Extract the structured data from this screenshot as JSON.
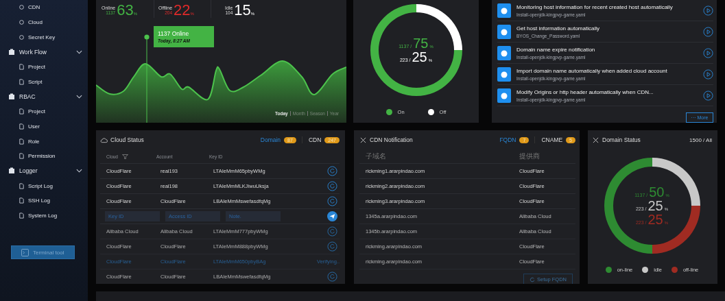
{
  "sidebar": {
    "items": [
      {
        "label": "CDN"
      },
      {
        "label": "Cloud"
      },
      {
        "label": "Secret Key"
      },
      {
        "label": "Work Flow",
        "expanded": true,
        "children": [
          {
            "label": "Project"
          },
          {
            "label": "Script"
          }
        ]
      },
      {
        "label": "RBAC",
        "expanded": true,
        "children": [
          {
            "label": "Project"
          },
          {
            "label": "User"
          },
          {
            "label": "Role"
          },
          {
            "label": "Permission"
          }
        ]
      },
      {
        "label": "Logger",
        "expanded": true,
        "children": [
          {
            "label": "Script Log"
          },
          {
            "label": "SSH Log"
          },
          {
            "label": "System Log"
          }
        ]
      }
    ],
    "terminal_button": "Terminal tool"
  },
  "activity": {
    "stats": [
      {
        "kind": "online",
        "label": "Online",
        "count": "1137",
        "percent": "63",
        "unit": "%"
      },
      {
        "kind": "offline",
        "label": "Offline",
        "count": "204",
        "percent": "22",
        "unit": "%"
      },
      {
        "kind": "idle",
        "label": "Idle",
        "count": "104",
        "percent": "15",
        "unit": "%"
      }
    ],
    "tooltip": {
      "title": "1137 Online",
      "time": "Today, 8:27 AM"
    },
    "ranges": [
      {
        "label": "Today",
        "selected": true
      },
      {
        "label": "Month",
        "selected": false
      },
      {
        "label": "Season",
        "selected": false
      },
      {
        "label": "Year",
        "selected": false
      }
    ]
  },
  "power": {
    "chart_data": {
      "type": "donut",
      "categories": [
        "On",
        "Off"
      ],
      "values": [
        75,
        25
      ]
    },
    "lines": [
      {
        "count": "1137 /",
        "percent": "75",
        "unit": "%"
      },
      {
        "count": "223 /",
        "percent": "25",
        "unit": "%"
      }
    ],
    "legend": [
      {
        "color": "#43b344"
      },
      {
        "color": "#ffffff"
      }
    ]
  },
  "workflows": {
    "items": [
      {
        "title": "Monitoring host information for recent created host automatically",
        "file": "Install-openjdk-kingpvp-game.yaml"
      },
      {
        "title": "Get host information automatically",
        "file": "BYOS_Change_Password.yaml"
      },
      {
        "title": "Domain name expire notification",
        "file": "Install-openjdk-kingpvp-game.yaml"
      },
      {
        "title": "Import domain name automatically when added cloud account",
        "file": "Install-openjdk-kingpvp-game.yaml"
      },
      {
        "title": "Modify Origins or http header automatically when CDN...",
        "file": "Install-openjdk-kingpvp-game.yaml"
      }
    ],
    "more": "··· More"
  },
  "cloud_status": {
    "title": "Cloud Status",
    "tabs": [
      {
        "label": "Domain",
        "count": "87",
        "selected": true
      },
      {
        "label": "CDN",
        "count": "247",
        "selected": false
      }
    ],
    "columns": [
      "Cloud",
      "Account",
      "Key ID"
    ],
    "rows": [
      {
        "kind": "data",
        "cloud": "CloudFlare",
        "account": "real193",
        "key_id": "LTAIeMmM65pbyWMg"
      },
      {
        "kind": "data",
        "cloud": "CloudFlare",
        "account": "real198",
        "key_id": "LTAIeMmMLKJiwuUksja"
      },
      {
        "kind": "data",
        "cloud": "CloudFlare",
        "account": "CloudFlare",
        "key_id": "LBAIeMmMswefasdfqMg"
      },
      {
        "kind": "input",
        "placeholders": [
          "Key ID",
          "Access ID",
          "Note."
        ]
      },
      {
        "kind": "data",
        "cloud": "Alibaba Cloud",
        "account": "Alibaba Cloud",
        "key_id": "LTAIeMmM777pbyWMg"
      },
      {
        "kind": "data",
        "cloud": "CloudFlare",
        "account": "CloudFlare",
        "key_id": "LTAIeMmM888pbyWMg"
      },
      {
        "kind": "verifying",
        "cloud": "CloudFlare",
        "account": "CloudFlare",
        "key_id": "LTAIeMmM650pbyBAg",
        "status": "Verifying.."
      },
      {
        "kind": "data",
        "cloud": "CloudFlare",
        "account": "CloudFlare",
        "key_id": "LBAIeMmMswefasdfqMg"
      }
    ]
  },
  "cdn_notification": {
    "title": "CDN Notification",
    "tabs": [
      {
        "label": "FQDN",
        "count": "7",
        "selected": true
      },
      {
        "label": "CNAME",
        "count": "5",
        "selected": false
      }
    ],
    "columns": [
      "子域名",
      "提供商"
    ],
    "rows": [
      {
        "domain": "rickming1.ararpindao.com",
        "provider": "CloudFlare"
      },
      {
        "domain": "rickming2.ararpindao.com",
        "provider": "CloudFlare"
      },
      {
        "domain": "rickming3.ararpindao.com",
        "provider": "CloudFlare"
      },
      {
        "domain": "1345a.ararpindao.com",
        "provider": "Alibaba Cloud"
      },
      {
        "domain": "1345b.ararpindao.com",
        "provider": "Alibaba Cloud"
      },
      {
        "domain": "rickming.ararpindao.com",
        "provider": "CloudFlare"
      },
      {
        "domain": "rickming.ararpindao.com",
        "provider": "CloudFlare"
      }
    ],
    "button": "Setup FQDN"
  },
  "domain_status": {
    "title": "Domain Status",
    "total": "1500 / All",
    "chart_data": {
      "type": "donut",
      "categories": [
        "on-line",
        "idle",
        "off-line"
      ],
      "values": [
        50,
        25,
        25
      ]
    },
    "lines": [
      {
        "count": "1137 /",
        "percent": "50",
        "unit": "%"
      },
      {
        "count": "223 /",
        "percent": "25",
        "unit": "%"
      },
      {
        "count": "223 /",
        "percent": "25",
        "unit": "%"
      }
    ],
    "legend": [
      {
        "color": "#2e8b32"
      },
      {
        "color": "#c8c8c8"
      },
      {
        "color": "#a02b22"
      }
    ]
  }
}
